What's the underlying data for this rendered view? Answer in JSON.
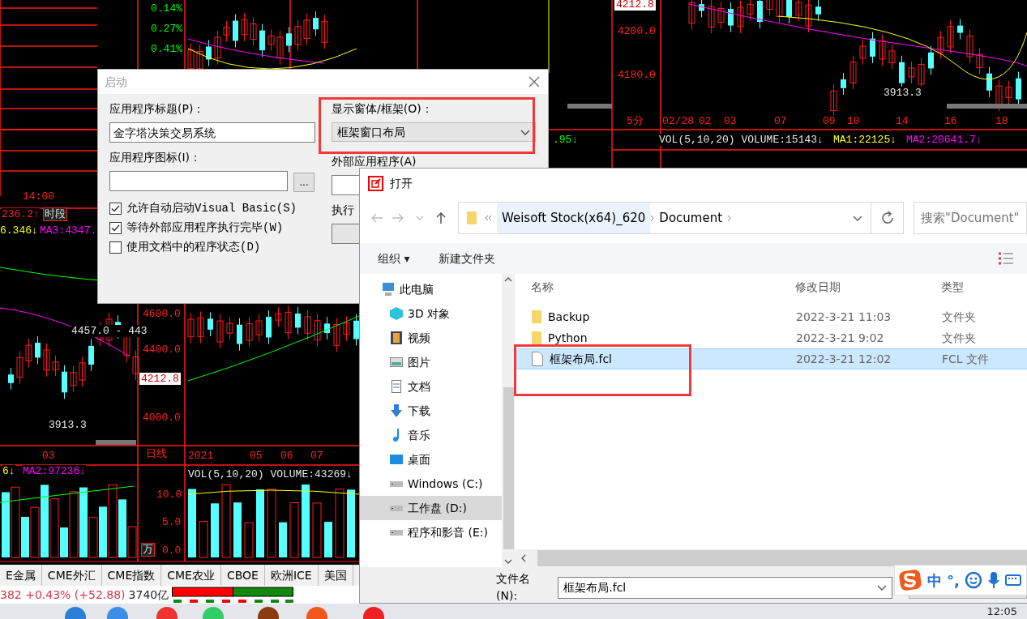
{
  "chart_labels": [
    {
      "text": "0.14%",
      "kind": "green"
    },
    {
      "text": "0.27%",
      "kind": "green"
    },
    {
      "text": "0.41%",
      "kind": "green"
    },
    {
      "text": "4212.8",
      "kind": "tag"
    },
    {
      "text": "4200.0",
      "kind": "red"
    },
    {
      "text": "4180.0",
      "kind": "red"
    },
    {
      "text": "14:00",
      "kind": "red"
    },
    {
      "text": "236.2↑",
      "kind": "red"
    },
    {
      "text": "时段",
      "kind": "button"
    },
    {
      "text": "6.346↓",
      "kind": "yellow"
    },
    {
      "text": "MA3:4347.",
      "kind": "magenta"
    },
    {
      "text": "4457.0 - 443",
      "kind": "white"
    },
    {
      "text": "4600.0",
      "kind": "red"
    },
    {
      "text": "4400.0",
      "kind": "red"
    },
    {
      "text": "4212.8",
      "kind": "tag"
    },
    {
      "text": "4000.0",
      "kind": "red"
    },
    {
      "text": "3913.3",
      "kind": "white"
    },
    {
      "text": "03",
      "kind": "red"
    },
    {
      "text": "日线",
      "kind": "red"
    },
    {
      "text": "2021",
      "kind": "red"
    },
    {
      "text": "05",
      "kind": "red"
    },
    {
      "text": "06",
      "kind": "red"
    },
    {
      "text": "07",
      "kind": "red"
    },
    {
      "text": "6↓",
      "kind": "yellow"
    },
    {
      "text": "MA2:97236↓",
      "kind": "magenta"
    },
    {
      "text": "VOL(5,10,20) VOLUME:43269↓",
      "kind": "white"
    },
    {
      "text": "10.0",
      "kind": "red"
    },
    {
      "text": "5.0",
      "kind": "red"
    },
    {
      "text": "0.0",
      "kind": "red"
    },
    {
      "text": "万",
      "kind": "button"
    },
    {
      "text": "5分",
      "kind": "red"
    },
    {
      "text": "02/28",
      "kind": "red"
    },
    {
      "text": "02",
      "kind": "red"
    },
    {
      "text": "03",
      "kind": "red"
    },
    {
      "text": "07",
      "kind": "red"
    },
    {
      "text": "09",
      "kind": "red"
    },
    {
      "text": "10",
      "kind": "red"
    },
    {
      "text": "14",
      "kind": "red"
    },
    {
      "text": "16",
      "kind": "red"
    },
    {
      "text": "18",
      "kind": "red"
    },
    {
      "text": "3913.3",
      "kind": "white"
    },
    {
      "text": ".95↓",
      "kind": "green"
    },
    {
      "text": "VOL(5,10,20) VOLUME:15143↓",
      "kind": "white"
    },
    {
      "text": "MA1:22125↓",
      "kind": "yellow"
    },
    {
      "text": "MA2:20641.7↓",
      "kind": "magenta"
    }
  ],
  "startup_dialog": {
    "title": "启动",
    "title_label": "应用程序标题(P)：",
    "title_value": "金字塔决策交易系统",
    "icon_label": "应用程序图标(I)：",
    "browse_button": "...",
    "options": [
      {
        "label": "允许自动启动Visual Basic(S)",
        "checked": true
      },
      {
        "label": "等待外部应用程序执行完毕(W)",
        "checked": true
      },
      {
        "label": "使用文档中的程序状态(D)",
        "checked": false
      }
    ],
    "display_label": "显示窗体/框架(O)：",
    "display_value": "框架窗口布局",
    "external_label": "外部应用程序(A)",
    "exec_label": "执行"
  },
  "open_dialog": {
    "title": "打开",
    "path": [
      "Weisoft Stock(x64)_620",
      "Document"
    ],
    "search": {
      "placeholder": "搜索\"Document\""
    },
    "toolbar": [
      "组织 ▾",
      "新建文件夹"
    ],
    "sidebar": [
      {
        "label": "此电脑",
        "kind": "pc",
        "selected": false
      },
      {
        "label": "3D 对象",
        "kind": "cube",
        "selected": false
      },
      {
        "label": "视频",
        "kind": "film",
        "selected": false
      },
      {
        "label": "图片",
        "kind": "image",
        "selected": false
      },
      {
        "label": "文档",
        "kind": "doc",
        "selected": false
      },
      {
        "label": "下载",
        "kind": "download",
        "selected": false
      },
      {
        "label": "音乐",
        "kind": "music",
        "selected": false
      },
      {
        "label": "桌面",
        "kind": "desktop",
        "selected": false
      },
      {
        "label": "Windows (C:)",
        "kind": "drive",
        "selected": false
      },
      {
        "label": "工作盘 (D:)",
        "kind": "drive",
        "selected": true
      },
      {
        "label": "程序和影音 (E:)",
        "kind": "drive",
        "selected": false
      }
    ],
    "columns": [
      "名称",
      "修改日期",
      "类型"
    ],
    "files": [
      {
        "name": "Backup",
        "kind": "folder",
        "date": "2022-3-21 11:03",
        "type": "文件夹",
        "selected": false
      },
      {
        "name": "Python",
        "kind": "folder",
        "date": "2022-3-21 9:02",
        "type": "文件夹",
        "selected": false
      },
      {
        "name": "框架布局.fcl",
        "kind": "file",
        "date": "2022-3-21 12:02",
        "type": "FCL 文件",
        "selected": true
      }
    ],
    "filename_label": "文件名(N):",
    "filename_value": "框架布局.fcl"
  },
  "ime_bar": {
    "mode": "中",
    "punctuation": "°,"
  },
  "market_tabs": [
    "E金属",
    "CME外汇",
    "CME指数",
    "CME农业",
    "CBOE",
    "欧洲ICE",
    "美国"
  ],
  "status_bar": {
    "quote": "382 +0.43% (+52.88)",
    "turnover": "3740亿"
  },
  "taskbar": {
    "clock": "12:05"
  }
}
